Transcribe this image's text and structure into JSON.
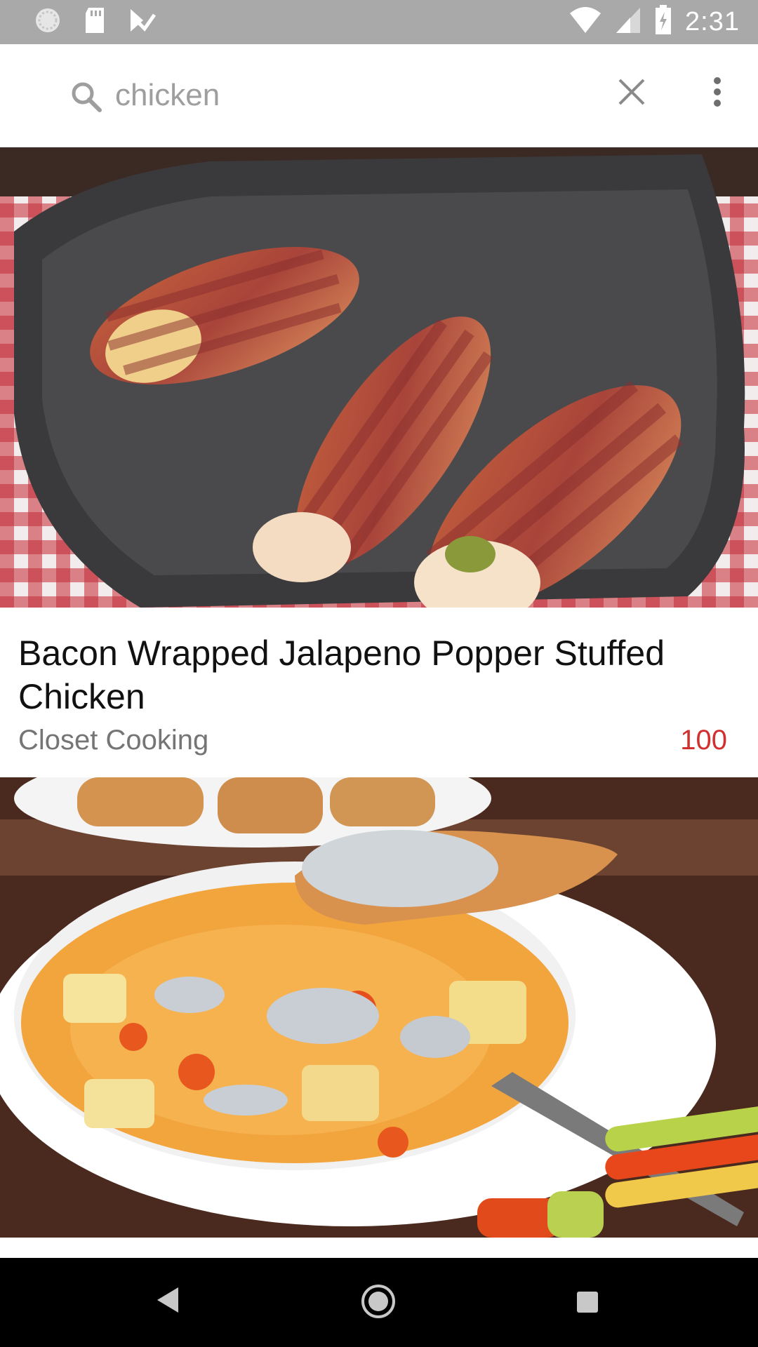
{
  "status_bar": {
    "time": "2:31",
    "icons": [
      "sync-icon",
      "sd-card-icon",
      "task-check-icon",
      "wifi-icon",
      "signal-icon",
      "battery-charging-icon"
    ]
  },
  "search": {
    "query": "chicken",
    "icons": {
      "search": "search-icon",
      "clear": "close-icon",
      "menu": "more-vert-icon"
    }
  },
  "results": [
    {
      "title": "Bacon Wrapped Jalapeno Popper Stuffed Chicken",
      "source": "Closet Cooking",
      "score": "100",
      "image_icon": "bacon-chicken-photo"
    },
    {
      "image_icon": "buffalo-chicken-soup-photo"
    }
  ],
  "nav_bar": {
    "icons": [
      "back-triangle-icon",
      "home-circle-icon",
      "recents-square-icon"
    ]
  },
  "colors": {
    "status_bar": "#a9a9a9",
    "score": "#d32f2f",
    "source_text": "#757575",
    "nav_bar": "#000000"
  }
}
